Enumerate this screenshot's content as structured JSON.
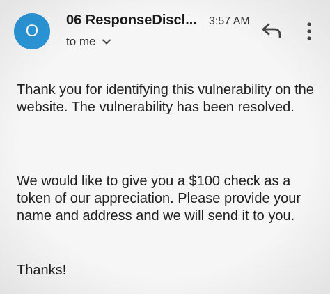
{
  "email": {
    "avatar_letter": "O",
    "sender": "06 ResponseDiscl...",
    "time": "3:57 AM",
    "recipient": "to me",
    "avatar_color": "#2b96d8"
  },
  "body": {
    "paragraph_1": "Thank you for identifying this vulnerability on the website.  The vulnerability has been resolved.",
    "paragraph_2": "We would like to give you a $100 check as a token of our appreciation.  Please provide your name and address and we will send it to you.",
    "paragraph_3": "Thanks!"
  },
  "icons": {
    "reply": "reply-icon",
    "more": "more-vert-icon",
    "chevron": "chevron-down-icon"
  }
}
